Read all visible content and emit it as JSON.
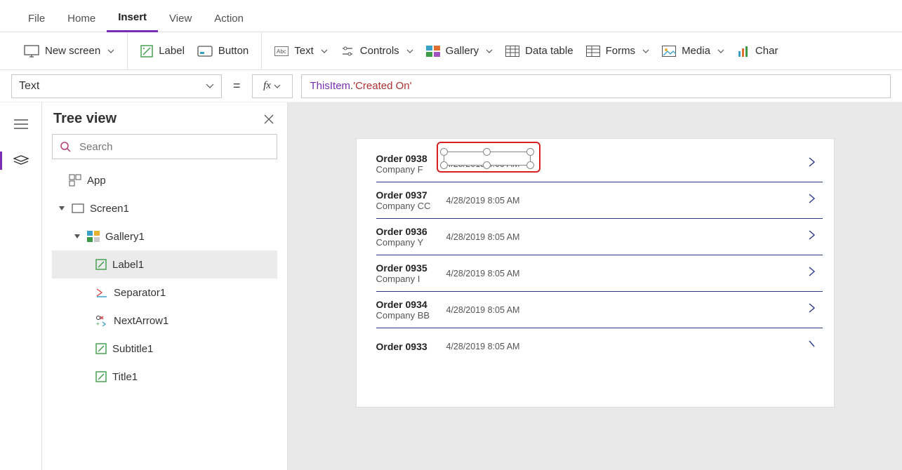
{
  "menu": {
    "file": "File",
    "home": "Home",
    "insert": "Insert",
    "view": "View",
    "action": "Action"
  },
  "ribbon": {
    "new_screen": "New screen",
    "label": "Label",
    "button": "Button",
    "text": "Text",
    "controls": "Controls",
    "gallery": "Gallery",
    "data_table": "Data table",
    "forms": "Forms",
    "media": "Media",
    "chart": "Char"
  },
  "property": {
    "selected": "Text",
    "eq": "="
  },
  "formula": {
    "obj": "ThisItem",
    "dot": ".",
    "field": "'Created On'"
  },
  "tree": {
    "title": "Tree view",
    "search_ph": "Search",
    "app": "App",
    "screen1": "Screen1",
    "gallery1": "Gallery1",
    "label1": "Label1",
    "separator1": "Separator1",
    "nextarrow1": "NextArrow1",
    "subtitle1": "Subtitle1",
    "title1": "Title1"
  },
  "gallery_rows": [
    {
      "title": "Order 0938",
      "sub": "Company F",
      "date": "4/28/2019 8:05 AM"
    },
    {
      "title": "Order 0937",
      "sub": "Company CC",
      "date": "4/28/2019 8:05 AM"
    },
    {
      "title": "Order 0936",
      "sub": "Company Y",
      "date": "4/28/2019 8:05 AM"
    },
    {
      "title": "Order 0935",
      "sub": "Company I",
      "date": "4/28/2019 8:05 AM"
    },
    {
      "title": "Order 0934",
      "sub": "Company BB",
      "date": "4/28/2019 8:05 AM"
    },
    {
      "title": "Order 0933",
      "sub": "",
      "date": "4/28/2019 8:05 AM"
    }
  ],
  "selected_label_text": "4/28/2019 8:05 AM"
}
